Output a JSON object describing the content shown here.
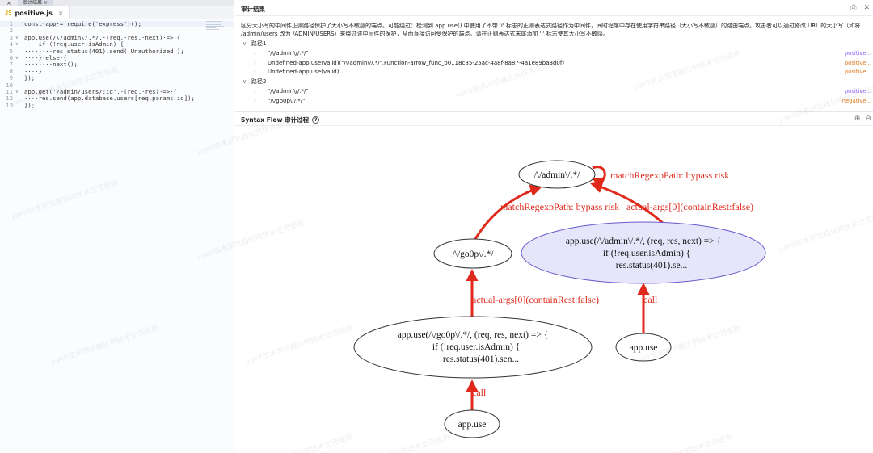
{
  "top_strip": {
    "tab_label": "审计结果 ×",
    "close": "×"
  },
  "editor": {
    "file_icon": "JS",
    "file_name": "positive.js",
    "close_glyph": "×",
    "lines": [
      {
        "n": "1",
        "fold": "",
        "text": "const·app·=·require('express')();"
      },
      {
        "n": "2",
        "fold": "",
        "text": ""
      },
      {
        "n": "3",
        "fold": "∨",
        "text": "app.use(/\\/admin\\/.*/,·(req,·res,·next)·=>·{"
      },
      {
        "n": "4",
        "fold": "∨",
        "text": "····if·(!req.user.isAdmin)·{"
      },
      {
        "n": "5",
        "fold": "",
        "text": "········res.status(401).send('Unauthorized');"
      },
      {
        "n": "6",
        "fold": "∨",
        "text": "····}·else·{"
      },
      {
        "n": "7",
        "fold": "",
        "text": "········next();"
      },
      {
        "n": "8",
        "fold": "",
        "text": "····}"
      },
      {
        "n": "9",
        "fold": "",
        "text": "});"
      },
      {
        "n": "10",
        "fold": "",
        "text": ""
      },
      {
        "n": "11",
        "fold": "∨",
        "text": "app.get('/admin/users/:id',·(req,·res)·=>·{"
      },
      {
        "n": "12",
        "fold": "",
        "text": "····res.send(app.database.users[req.params.id]);"
      },
      {
        "n": "13",
        "fold": "",
        "text": "});"
      }
    ]
  },
  "audit": {
    "title": "审计结果",
    "icons": [
      "print-icon",
      "close-icon"
    ],
    "description": "区分大小写的中间件正则路径保护了大小写不敏感的端点。可能绕过：检测到 app.use() 中使用了不带 'i' 标志的正则表达式路径作为中间件，同时程序中存在使用字符串路径（大小写不敏感）的路由端点。攻击者可以通过修改 URL 的大小写（如将 /admin/users 改为 /ADMIN/USERS）来绕过该中间件的保护，从而直接访问受保护的端点。请在正则表达式末尾添加 'i' 标志使其大小写不敏感。",
    "groups": [
      {
        "label": "路径1",
        "items": [
          {
            "text": "\"/\\/admin\\//.*/\"",
            "status": "positive...",
            "kind": "positive"
          },
          {
            "text": "Undefined-app.use(valid)(\"/\\/admin\\//.*/\",Function-arrow_func_b0118c85-25ac-4a8f-8a87-4a1e89ba3d0f)",
            "status": "positive...",
            "kind": "negative"
          },
          {
            "text": "Undefined-app.use(valid)",
            "status": "positive...",
            "kind": "negative"
          }
        ]
      },
      {
        "label": "路径2",
        "items": [
          {
            "text": "\"/\\/admin\\//.*/\"",
            "status": "positive...",
            "kind": "positive"
          },
          {
            "text": "\"/\\/go0p\\//.*/\"",
            "status": "negative...",
            "kind": "negative"
          }
        ]
      }
    ]
  },
  "syntax_flow": {
    "title": "Syntax Flow 审计过程",
    "help_icon": "?",
    "icons": [
      "zoom-in-icon",
      "zoom-out-icon"
    ]
  },
  "graph": {
    "nodes": {
      "admin": "/\\/admin\\/.*/",
      "go0p": "/\\/go0p\\/.*/",
      "use_admin": [
        "app.use(/\\/admin\\/.*/, (req, res, next) => {",
        "if (!req.user.isAdmin) {",
        "res.status(401).se..."
      ],
      "use_go0p": [
        "app.use(/\\/go0p\\/.*/, (req, res, next) => {",
        "if (!req.user.isAdmin) {",
        "res.status(401).sen..."
      ],
      "appuse_right": "app.use",
      "appuse_bottom": "app.use"
    },
    "edges": {
      "self_loop": "matchRegexpPath: bypass risk",
      "go0p_to_admin": "matchRegexpPath: bypass risk",
      "useadmin_to_admin": "actual-args[0](containRest:false)",
      "usego0p_to_go0p": "actual-args[0](containRest:false)",
      "call_right": "call",
      "call_bottom": "call"
    },
    "colors": {
      "edge": "#e0291b",
      "highlight_fill": "#e6e6fa",
      "highlight_stroke": "#6a5acd"
    }
  },
  "watermark_text": "yakit技术浏览器仅供技术交流使用"
}
